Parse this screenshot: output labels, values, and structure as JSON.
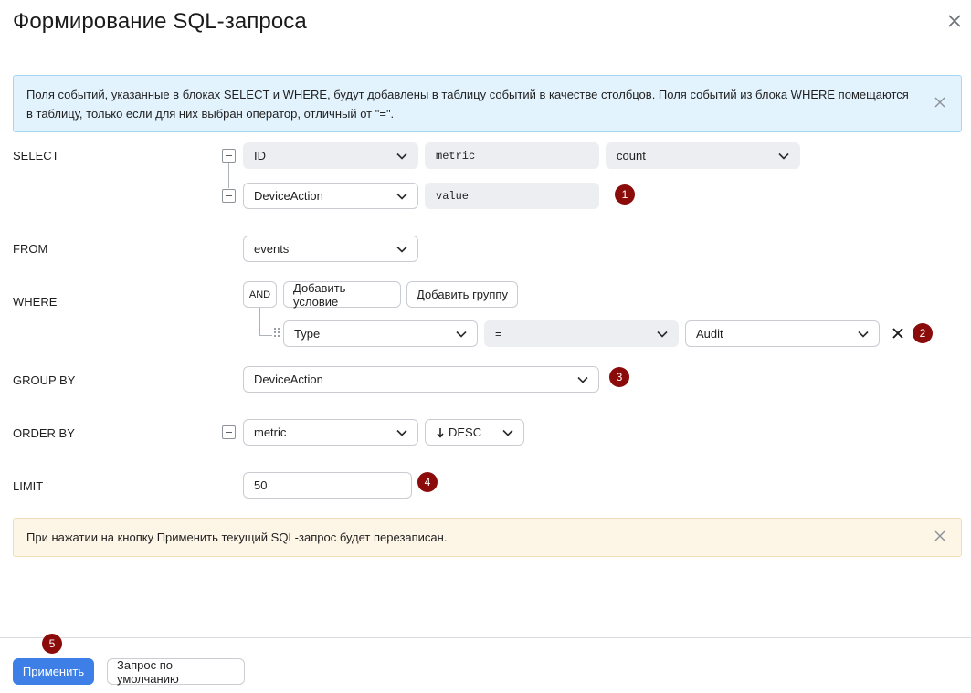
{
  "dialog": {
    "title": "Формирование SQL-запроса",
    "close_icon": "close-icon"
  },
  "info_banner": {
    "text": "Поля событий, указанные в блоках SELECT и WHERE, будут добавлены в таблицу событий в качестве столбцов. Поля событий из блока WHERE помещаются в таблицу, только если для них выбран оператор, отличный от \"=\"."
  },
  "select": {
    "label": "SELECT",
    "rows": [
      {
        "field": "ID",
        "alias": "metric",
        "aggregate": "count"
      },
      {
        "field": "DeviceAction",
        "alias": "value"
      }
    ]
  },
  "from": {
    "label": "FROM",
    "value": "events"
  },
  "where": {
    "label": "WHERE",
    "logic": "AND",
    "add_condition": "Добавить условие",
    "add_group": "Добавить группу",
    "condition": {
      "field": "Type",
      "operator": "=",
      "value": "Audit"
    }
  },
  "group_by": {
    "label": "GROUP BY",
    "value": "DeviceAction"
  },
  "order_by": {
    "label": "ORDER BY",
    "field": "metric",
    "direction": "DESC"
  },
  "limit": {
    "label": "LIMIT",
    "value": "50"
  },
  "warn_banner": {
    "text": "При нажатии на кнопку Применить текущий SQL-запрос будет перезаписан."
  },
  "markers": [
    "1",
    "2",
    "3",
    "4",
    "5"
  ],
  "footer": {
    "apply": "Применить",
    "default_query": "Запрос по умолчанию"
  },
  "colors": {
    "primary": "#3d7fe6",
    "marker": "#8b0b0b",
    "info_bg": "#e3f3fd",
    "warn_bg": "#fdf5e6"
  }
}
